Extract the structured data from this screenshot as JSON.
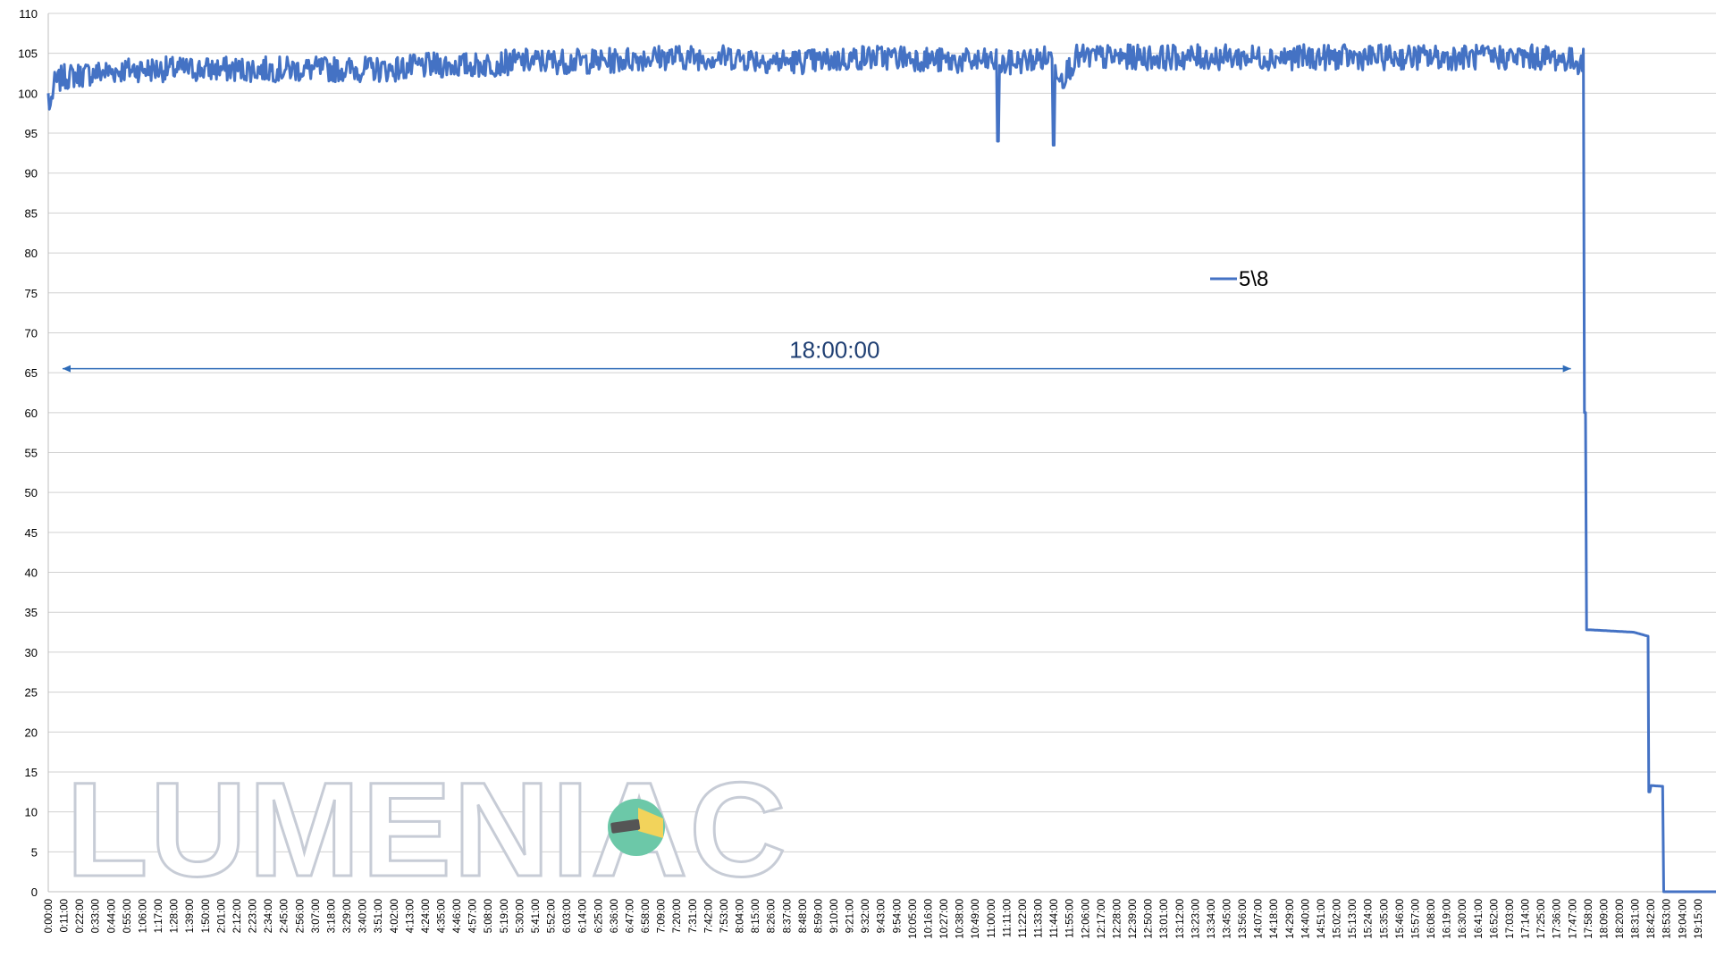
{
  "chart_data": {
    "type": "line",
    "title": "",
    "xlabel": "",
    "ylabel": "",
    "ylim": [
      0,
      110
    ],
    "y_ticks": [
      0,
      5,
      10,
      15,
      20,
      25,
      30,
      35,
      40,
      45,
      50,
      55,
      60,
      65,
      70,
      75,
      80,
      85,
      90,
      95,
      100,
      105,
      110
    ],
    "x_tick_labels": [
      "0:00:00",
      "0:11:00",
      "0:22:00",
      "0:33:00",
      "0:44:00",
      "0:55:00",
      "1:06:00",
      "1:17:00",
      "1:28:00",
      "1:39:00",
      "1:50:00",
      "2:01:00",
      "2:12:00",
      "2:23:00",
      "2:34:00",
      "2:45:00",
      "2:56:00",
      "3:07:00",
      "3:18:00",
      "3:29:00",
      "3:40:00",
      "3:51:00",
      "4:02:00",
      "4:13:00",
      "4:24:00",
      "4:35:00",
      "4:46:00",
      "4:57:00",
      "5:08:00",
      "5:19:00",
      "5:30:00",
      "5:41:00",
      "5:52:00",
      "6:03:00",
      "6:14:00",
      "6:25:00",
      "6:36:00",
      "6:47:00",
      "6:58:00",
      "7:09:00",
      "7:20:00",
      "7:31:00",
      "7:42:00",
      "7:53:00",
      "8:04:00",
      "8:15:00",
      "8:26:00",
      "8:37:00",
      "8:48:00",
      "8:59:00",
      "9:10:00",
      "9:21:00",
      "9:32:00",
      "9:43:00",
      "9:54:00",
      "10:05:00",
      "10:16:00",
      "10:27:00",
      "10:38:00",
      "10:49:00",
      "11:00:00",
      "11:11:00",
      "11:22:00",
      "11:33:00",
      "11:44:00",
      "11:55:00",
      "12:06:00",
      "12:17:00",
      "12:28:00",
      "12:39:00",
      "12:50:00",
      "13:01:00",
      "13:12:00",
      "13:23:00",
      "13:34:00",
      "13:45:00",
      "13:56:00",
      "14:07:00",
      "14:18:00",
      "14:29:00",
      "14:40:00",
      "14:51:00",
      "15:02:00",
      "15:13:00",
      "15:24:00",
      "15:35:00",
      "15:46:00",
      "15:57:00",
      "16:08:00",
      "16:19:00",
      "16:30:00",
      "16:41:00",
      "16:52:00",
      "17:03:00",
      "17:14:00",
      "17:25:00",
      "17:36:00",
      "17:47:00",
      "17:58:00",
      "18:09:00",
      "18:20:00",
      "18:31:00",
      "18:42:00",
      "18:53:00",
      "19:04:00",
      "19:15:00"
    ],
    "grid": true,
    "legend_position": "right-middle",
    "series": [
      {
        "name": "5\\8",
        "color": "#4472c4",
        "x_unit": "minutes",
        "x": [
          0,
          1,
          4,
          10,
          30,
          60,
          90,
          120,
          150,
          180,
          210,
          240,
          270,
          300,
          330,
          360,
          390,
          420,
          450,
          480,
          510,
          540,
          570,
          600,
          630,
          660,
          664,
          665,
          666,
          680,
          703,
          704,
          705,
          710,
          720,
          750,
          780,
          810,
          840,
          870,
          900,
          930,
          960,
          990,
          1020,
          1050,
          1070,
          1075,
          1076,
          1077,
          1080,
          1110,
          1120,
          1121,
          1122,
          1130,
          1131,
          1132,
          1160,
          1170
        ],
        "y": [
          100,
          98,
          101,
          102,
          102.5,
          103,
          103,
          103,
          103,
          103,
          103,
          103,
          103.5,
          103.5,
          104,
          104,
          104,
          104.5,
          104.5,
          104.5,
          104,
          104,
          104.5,
          104.5,
          104,
          104,
          104,
          94,
          103.5,
          104,
          104.5,
          93.5,
          103.5,
          102,
          104.5,
          104.5,
          104.5,
          104.5,
          104.5,
          104.5,
          104.5,
          104.5,
          104.5,
          104.5,
          104.5,
          104.5,
          104,
          104,
          60,
          32.8,
          32.8,
          32.5,
          32,
          12.5,
          13.3,
          13.2,
          0,
          0,
          0,
          0
        ]
      }
    ],
    "annotations": [
      {
        "text": "18:00:00",
        "type": "double-arrow",
        "x_from": 10,
        "x_to": 1066,
        "y": 65.5
      }
    ]
  },
  "watermark": {
    "text": "LUMENIAC",
    "logo_icon": "flashlight-icon",
    "logo_colors": {
      "circle": "#6cc8a8",
      "beam": "#f2d35b",
      "body": "#555555"
    }
  },
  "colors": {
    "grid": "#d0d0d0",
    "line": "#4472c4",
    "annotation": "#2e6bb8"
  }
}
